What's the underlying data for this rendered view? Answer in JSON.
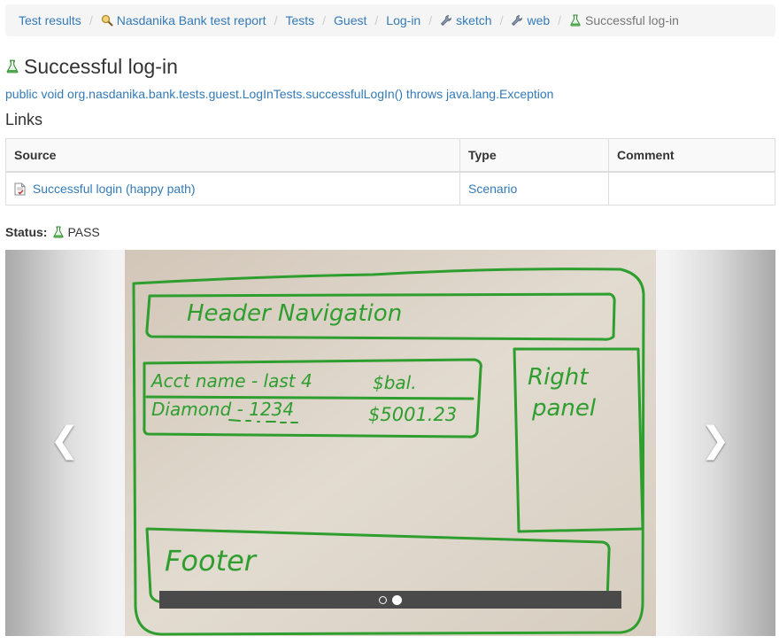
{
  "breadcrumb": [
    {
      "label": "Test results",
      "icon": null
    },
    {
      "label": "Nasdanika Bank test report",
      "icon": "report-icon"
    },
    {
      "label": "Tests",
      "icon": null
    },
    {
      "label": "Guest",
      "icon": null
    },
    {
      "label": "Log-in",
      "icon": null
    },
    {
      "label": "sketch",
      "icon": "wrench-icon"
    },
    {
      "label": "web",
      "icon": "wrench-icon"
    },
    {
      "label": "Successful log-in",
      "icon": "flask-icon"
    }
  ],
  "page": {
    "title": "Successful log-in",
    "signature": "public void org.nasdanika.bank.tests.guest.LogInTests.successfulLogIn() throws java.lang.Exception",
    "links_heading": "Links"
  },
  "links_table": {
    "columns": [
      "Source",
      "Type",
      "Comment"
    ],
    "rows": [
      {
        "source": "Successful login (happy path)",
        "type": "Scenario",
        "comment": ""
      }
    ]
  },
  "status": {
    "label": "Status:",
    "value": "PASS"
  },
  "carousel": {
    "slides_total": 2,
    "active_slide": 2,
    "prev_glyph": "❮",
    "next_glyph": "❯",
    "sketch_text": {
      "header": "Header Navigation",
      "acct": "Acct name - last 4",
      "bal": "$bal.",
      "diamond": "Diamond - 1234",
      "amount": "$5001.23",
      "right": "Right",
      "panel": "panel",
      "footer": "Footer"
    }
  },
  "colors": {
    "link": "#337ab7",
    "breadcrumb_bg": "#f5f5f5",
    "marker_green": "#2e9e2e",
    "whiteboard": "#d9d0c4"
  }
}
